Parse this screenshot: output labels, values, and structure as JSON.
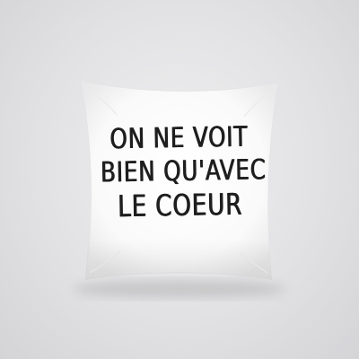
{
  "product": {
    "type": "throw pillow",
    "pillow_color": "#fdfdfd",
    "background_color": "#e2e2e4",
    "ink_color": "#1e1e1e"
  },
  "quote": {
    "line1": "ON NE VOIT",
    "line2": "BIEN QU'AVEC",
    "line3": "LE COEUR"
  }
}
